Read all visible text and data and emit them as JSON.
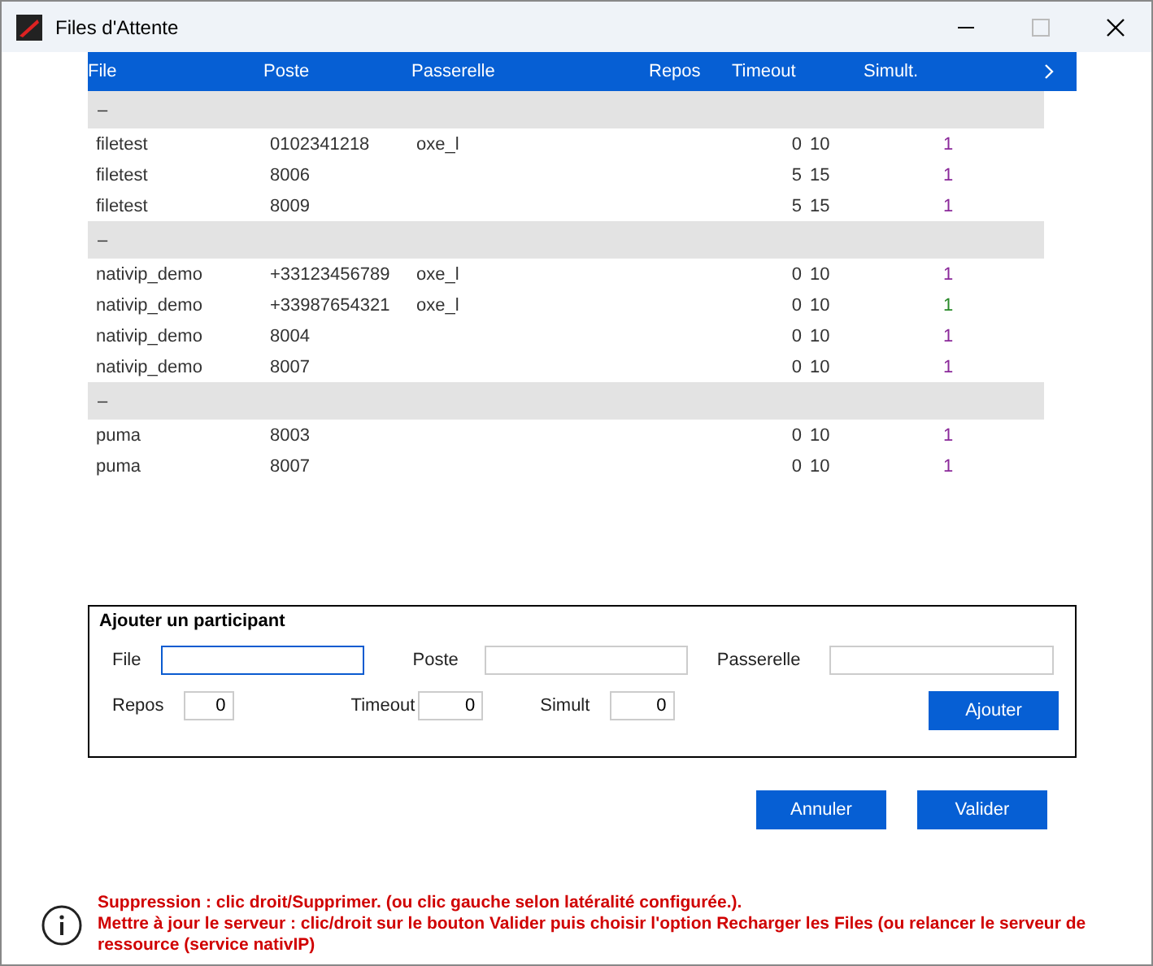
{
  "window": {
    "title": "Files d'Attente"
  },
  "table": {
    "columns": [
      "File",
      "Poste",
      "Passerelle",
      "Repos",
      "Timeout",
      "Simult."
    ],
    "groups": [
      {
        "label": "–",
        "rows": [
          {
            "file": "filetest",
            "poste": "0102341218",
            "passerelle": "oxe_l",
            "repos": "0",
            "timeout": "10",
            "simult": "1",
            "color": "#8b2a9a"
          },
          {
            "file": "filetest",
            "poste": "8006",
            "repos": "5",
            "timeout": "15",
            "simult": "1",
            "color": "#8b2a9a"
          },
          {
            "file": "filetest",
            "poste": "8009",
            "repos": "5",
            "timeout": "15",
            "simult": "1",
            "color": "#8b2a9a"
          }
        ]
      },
      {
        "label": "–",
        "rows": [
          {
            "file": "nativip_demo",
            "poste": "+33123456789",
            "passerelle": "oxe_l",
            "repos": "0",
            "timeout": "10",
            "simult": "1",
            "color": "#8b2a9a"
          },
          {
            "file": "nativip_demo",
            "poste": "+33987654321",
            "passerelle": "oxe_l",
            "repos": "0",
            "timeout": "10",
            "simult": "1",
            "color": "#2a8a2a"
          },
          {
            "file": "nativip_demo",
            "poste": "8004",
            "repos": "0",
            "timeout": "10",
            "simult": "1",
            "color": "#8b2a9a"
          },
          {
            "file": "nativip_demo",
            "poste": "8007",
            "repos": "0",
            "timeout": "10",
            "simult": "1",
            "color": "#8b2a9a"
          }
        ]
      },
      {
        "label": "–",
        "rows": [
          {
            "file": "puma",
            "poste": "8003",
            "repos": "0",
            "timeout": "10",
            "simult": "1",
            "color": "#8b2a9a"
          },
          {
            "file": "puma",
            "poste": "8007",
            "repos": "0",
            "timeout": "10",
            "simult": "1",
            "color": "#8b2a9a"
          }
        ]
      }
    ]
  },
  "add_form": {
    "title": "Ajouter un participant",
    "file": {
      "label": "File"
    },
    "poste": {
      "label": "Poste"
    },
    "passerelle": {
      "label": "Passerelle"
    },
    "repos": {
      "label": "Repos",
      "value": "0"
    },
    "timeout": {
      "label": "Timeout",
      "value": "0"
    },
    "simult": {
      "label": "Simult",
      "value": "0"
    },
    "button": "Ajouter"
  },
  "buttons": [
    "Annuler",
    "Valider"
  ],
  "info": [
    "Suppression  : clic droit/Supprimer. (ou clic gauche selon latéralité configurée.).",
    "Mettre à jour le serveur : clic/droit sur le bouton Valider puis choisir l'option Recharger les Files (ou relancer le serveur de ressource (service nativIP)"
  ]
}
